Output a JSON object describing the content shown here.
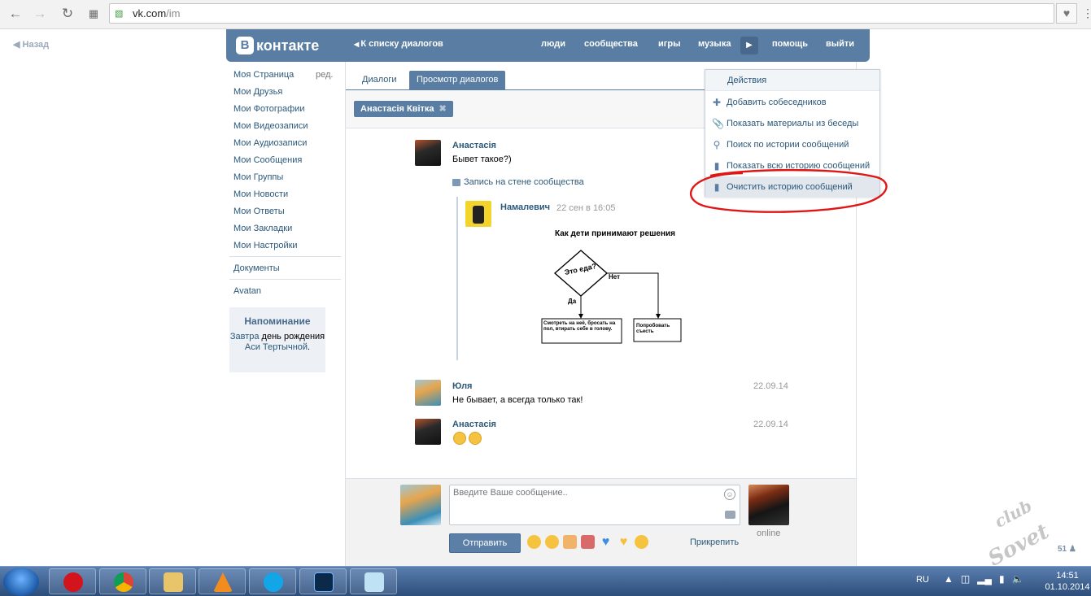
{
  "browser": {
    "url_domain": "vk.com",
    "url_path": "/im"
  },
  "back_label": "Назад",
  "header": {
    "logo_letter": "В",
    "logo_text": "контакте",
    "to_list": "К списку диалогов",
    "nav": [
      "люди",
      "сообщества",
      "игры",
      "музыка",
      "помощь",
      "выйти"
    ]
  },
  "left_menu": {
    "items": [
      "Моя Страница",
      "Мои Друзья",
      "Мои Фотографии",
      "Мои Видеозаписи",
      "Мои Аудиозаписи",
      "Мои Сообщения",
      "Мои Группы",
      "Мои Новости",
      "Мои Ответы",
      "Мои Закладки",
      "Мои Настройки"
    ],
    "edit": "ред.",
    "docs": "Документы",
    "avatan": "Avatan",
    "reminder": {
      "title": "Напоминание",
      "w1": "Завтра",
      "w2": "день рождения",
      "w3": "Аси Тертычной",
      "dot": "."
    }
  },
  "tabs": [
    "Диалоги",
    "Просмотр диалогов"
  ],
  "peer_chip": "Анастасія Квітка",
  "messages": {
    "m1": {
      "name": "Анастасія",
      "text": "Бывет такое?)"
    },
    "wall_link": "Запись на стене сообщества",
    "wall": {
      "name": "Намалевич",
      "date": "22 сен в 16:05"
    },
    "flowchart": {
      "title": "Как дети принимают решения",
      "question": "Это еда?",
      "no": "Нет",
      "yes": "Да",
      "box_yes": "Смотреть на неё, бросать на пол, втирать себе в голову.",
      "box_no": "Попробовать съесть"
    },
    "m2": {
      "name": "Юля",
      "date": "22.09.14",
      "text": "Не бывает, а всегда только так!"
    },
    "m3": {
      "name": "Анастасія",
      "date": "22.09.14"
    }
  },
  "dropdown": {
    "header": "Действия",
    "items": [
      "Добавить собеседников",
      "Показать материалы из беседы",
      "Поиск по истории сообщений",
      "Показать всю историю сообщений",
      "Очистить историю сообщений"
    ]
  },
  "composer": {
    "placeholder": "Введите Ваше сообщение..",
    "send": "Отправить",
    "attach": "Прикрепить",
    "online": "online"
  },
  "watermark": {
    "l1": "club",
    "l2": "Sovet"
  },
  "counter": "51",
  "taskbar": {
    "lang": "RU",
    "time": "14:51",
    "date": "01.10.2014"
  }
}
